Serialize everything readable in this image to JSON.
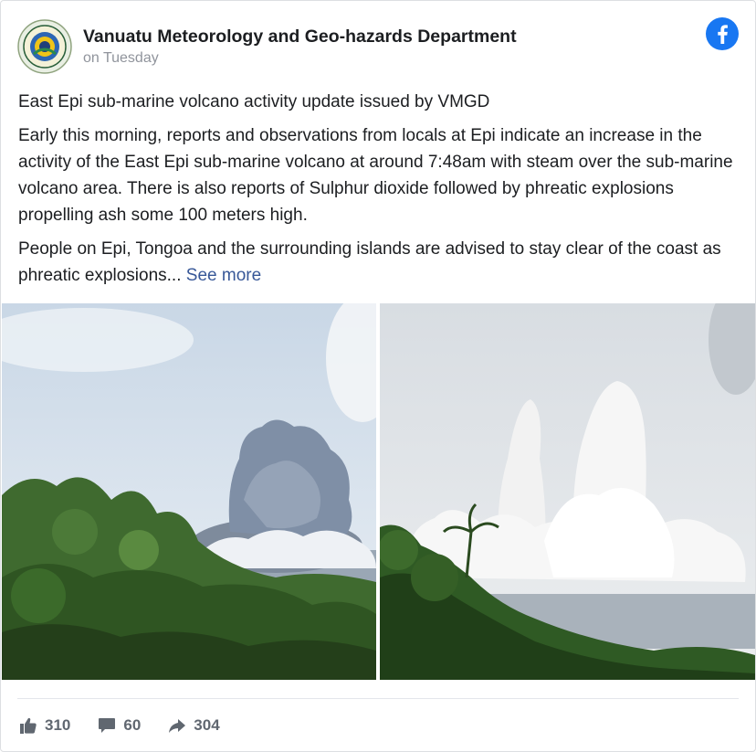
{
  "post": {
    "page_name": "Vanuatu Meteorology and Geo-hazards Department",
    "timestamp": "on Tuesday",
    "paragraphs": [
      "East Epi sub-marine volcano activity update issued by VMGD",
      "Early this morning, reports and observations from locals at Epi indicate an increase in the activity of the East Epi sub-marine volcano at around 7:48am with steam over the sub-marine volcano area. There is also reports of Sulphur dioxide followed by phreatic explosions propelling ash some 100 meters high."
    ],
    "truncated_paragraph": "People on Epi, Tongoa and the surrounding islands are advised to stay clear of the coast as phreatic explosions...",
    "see_more": "See more"
  },
  "counts": {
    "likes": "310",
    "comments": "60",
    "shares": "304"
  },
  "icons": {
    "logo": "department-seal-icon",
    "brand": "facebook-icon",
    "like": "thumbs-up-icon",
    "comment": "comment-bubble-icon",
    "share": "share-arrow-icon"
  },
  "colors": {
    "brand": "#1877f2",
    "link": "#385898",
    "meta_text": "#90949c",
    "action_text": "#606770"
  }
}
